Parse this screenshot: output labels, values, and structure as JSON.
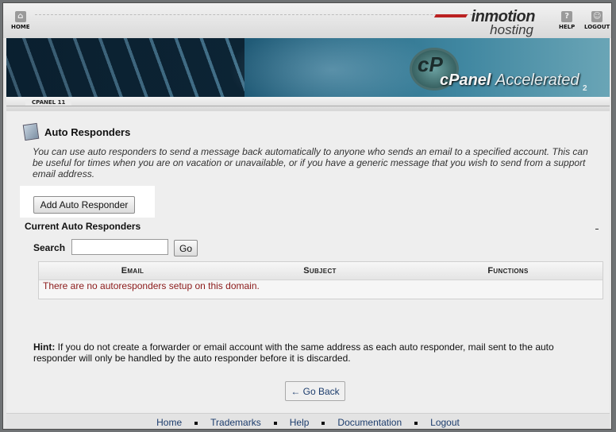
{
  "topbar": {
    "home_label": "HOME",
    "help_label": "HELP",
    "logout_label": "LOGOUT",
    "brand_line1": "inmotion",
    "brand_line2": "hosting"
  },
  "banner": {
    "logo_cp": "cP",
    "logo_text1": "cPanel",
    "logo_text2": "Accelerated",
    "logo_version": "2"
  },
  "version_strip": {
    "label": "CPANEL 11"
  },
  "page": {
    "title": "Auto Responders",
    "intro": "You can use auto responders to send a message back automatically to anyone who sends an email to a specified account. This can be useful for times when you are on vacation or unavailable, or if you have a generic message that you wish to send from a support email address.",
    "add_button": "Add Auto Responder",
    "section_title": "Current Auto Responders",
    "search_label": "Search",
    "search_value": "",
    "go_button": "Go",
    "table": {
      "headers": [
        "Email",
        "Subject",
        "Functions"
      ],
      "empty_message": "There are no autoresponders setup on this domain."
    },
    "hint_label": "Hint:",
    "hint_text": " If you do not create a forwarder or email account with the same address as each auto responder, mail sent to the auto responder will only be handled by the auto responder before it is discarded.",
    "back_button": "← Go Back"
  },
  "footer": {
    "links": [
      "Home",
      "Trademarks",
      "Help",
      "Documentation",
      "Logout"
    ]
  },
  "colors": {
    "link": "#1d3d6d",
    "error_text": "#8b1a1a",
    "page_bg": "#eeeeee"
  }
}
